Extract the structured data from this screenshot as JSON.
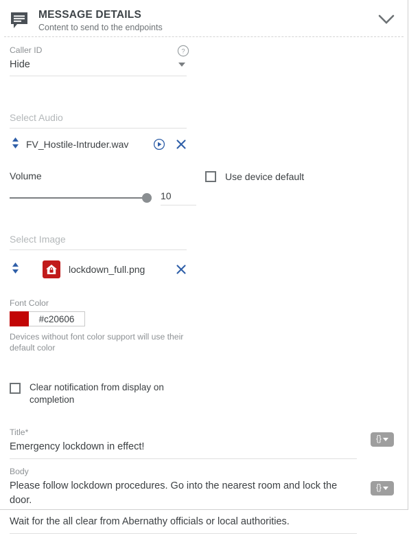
{
  "header": {
    "icon": "message-bubble-icon",
    "title": "MESSAGE DETAILS",
    "subtitle": "Content to send to the endpoints",
    "collapse_icon": "chevron-down-icon"
  },
  "caller_id": {
    "label": "Caller ID",
    "value": "Hide",
    "help_icon": "help-circle-icon",
    "dropdown_icon": "caret-down-icon"
  },
  "audio": {
    "section_label": "Select Audio",
    "item": {
      "name": "FV_Hostile-Intruder.wav",
      "sort_icon": "sort-updown-icon",
      "play_icon": "play-circle-icon",
      "remove_icon": "close-x-icon"
    },
    "volume": {
      "label": "Volume",
      "value": "10",
      "slider_percent": 92
    },
    "use_device_default": {
      "label": "Use device default",
      "checked": false
    }
  },
  "image": {
    "section_label": "Select Image",
    "item": {
      "name": "lockdown_full.png",
      "sort_icon": "sort-updown-icon",
      "thumbnail_icon": "house-lock-icon",
      "thumbnail_color": "#c11b1b",
      "remove_icon": "close-x-icon"
    }
  },
  "font_color": {
    "label": "Font Color",
    "value": "#c20606",
    "swatch_color": "#c20606",
    "help_text": "Devices without font color support will use their default color"
  },
  "clear_notification": {
    "label": "Clear notification from display on completion",
    "checked": false
  },
  "title_field": {
    "label": "Title",
    "required_marker": "*",
    "value": "Emergency lockdown in effect!",
    "token_button": {
      "label": "{}",
      "icon": "caret-down-icon"
    }
  },
  "body_field": {
    "label": "Body",
    "line1": "Please follow lockdown procedures. Go into the nearest room and lock the door.",
    "line2": "Wait for the all clear from Abernathy officials or local authorities.",
    "token_button": {
      "label": "{}",
      "icon": "caret-down-icon"
    }
  }
}
